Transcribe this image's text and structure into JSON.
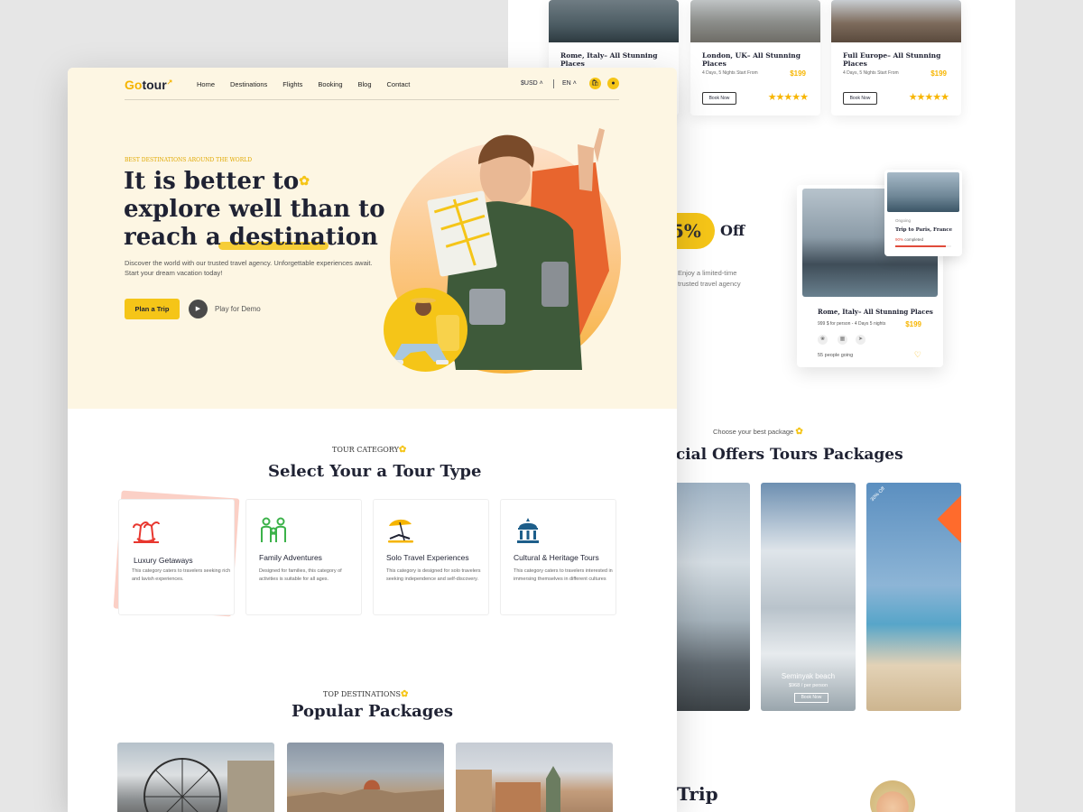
{
  "bg": {
    "top_cards": [
      {
        "title": "Rome, Italy– All Stunning Places",
        "meta": "",
        "price": "",
        "book": "",
        "stars": ""
      },
      {
        "title": "London, UK– All Stunning Places",
        "meta": "4 Days, 5 Nights Start From",
        "price": "$199",
        "book": "Book Now",
        "stars": "★★★★★"
      },
      {
        "title": "Full Europe– All Stunning Places",
        "meta": "4 Days, 5 Nights Start From",
        "price": "$199",
        "book": "Book Now",
        "stars": "★★★★★"
      }
    ],
    "offer": {
      "percent": "5%",
      "off": "Off",
      "text": "Enjoy a limited-time trusted travel agency"
    },
    "trip_card": {
      "title": "Rome, Italy– All Stunning Places",
      "meta": "999 $ for person - 4 Days 5 nights",
      "price": "$199",
      "going": "55 people going"
    },
    "ongoing": {
      "label": "Ongoing",
      "title": "Trip to  Paris, France",
      "percent": "90%",
      "completed": " completed",
      "progress": 0.9
    },
    "special": {
      "kicker": "Choose your best package",
      "title": "ecial Offers Tours Packages",
      "place": "Seminyak beach",
      "price": "$968 / per person",
      "book": "Book Now",
      "ribbon": "30% Off"
    },
    "trip_word": "Trip"
  },
  "front": {
    "logo": {
      "go": "Go",
      "tour": "tour"
    },
    "nav": [
      "Home",
      "Destinations",
      "Flights",
      "Booking",
      "Blog",
      "Contact"
    ],
    "currency": "$USD",
    "lang": "EN",
    "kicker": "BEST DESTINATIONS AROUND THE WORLD",
    "headline": [
      "It is better to",
      "explore well than to",
      "reach a destination"
    ],
    "description": "Discover the world with our trusted travel agency. Unforgettable experiences await. Start your dream vacation today!",
    "cta": "Plan a Trip",
    "play": "Play for Demo",
    "category": {
      "kicker": "TOUR CATEGORY",
      "title": "Select Your  a Tour Type",
      "cards": [
        {
          "title": "Luxury Getaways",
          "desc": "This category caters to travelers seeking rich and lavish experiences.",
          "icon": "palm-tree-icon",
          "color": "#e8372f"
        },
        {
          "title": "Family Adventures",
          "desc": "Designed for families, this category of activities is suitable for all ages.",
          "icon": "family-icon",
          "color": "#3cb24a"
        },
        {
          "title": "Solo Travel Experiences",
          "desc": "This category is designed for solo travelers seeking independence and self-discovery.",
          "icon": "beach-umbrella-icon",
          "color": "#f5b400"
        },
        {
          "title": "Cultural & Heritage Tours",
          "desc": "This category caters to travelers interested in immersing themselves in different cultures",
          "icon": "heritage-icon",
          "color": "#1d5e8a"
        }
      ]
    },
    "popular": {
      "kicker": "TOP DESTINATIONS",
      "title": "Popular Packages"
    }
  },
  "colors": {
    "accent": "#f5c518",
    "hero_bg": "#fdf6e3",
    "price": "#f7b500",
    "ribbon": "#ff6b2c"
  }
}
